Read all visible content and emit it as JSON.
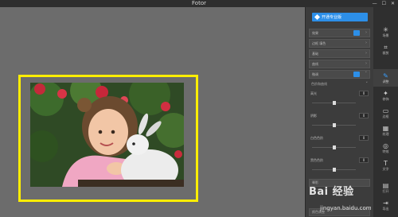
{
  "window": {
    "title": "Fotor",
    "min_label": "—",
    "max_label": "☐",
    "close_label": "✕"
  },
  "panel": {
    "vip_label": "开通专业版",
    "rows": [
      {
        "label": "效果",
        "has_tag": true
      },
      {
        "label": "边框 填色",
        "has_tag": false
      },
      {
        "label": "基础",
        "has_tag": false
      },
      {
        "label": "曲线",
        "has_tag": false
      },
      {
        "label": "微调",
        "has_tag": true
      }
    ],
    "sub_row_label": "色阶和曲线",
    "sliders": [
      {
        "label": "高光",
        "value": "0",
        "level": 0.5
      },
      {
        "label": "阴影",
        "value": "0",
        "level": 0.5
      },
      {
        "label": "白色色阶",
        "value": "0",
        "level": 0.5
      },
      {
        "label": "黑色色阶",
        "value": "0",
        "level": 0.5
      }
    ],
    "footer_rows": [
      "晕影",
      "颜色调整"
    ]
  },
  "tools": [
    {
      "name": "scene",
      "icon": "✳",
      "label": "场景"
    },
    {
      "name": "crop",
      "icon": "⌗",
      "label": "裁剪"
    },
    {
      "name": "adjust",
      "icon": "✎",
      "label": "调整",
      "active": true
    },
    {
      "name": "retouch",
      "icon": "✦",
      "label": "修饰"
    },
    {
      "name": "frame",
      "icon": "▭",
      "label": "边框"
    },
    {
      "name": "texture",
      "icon": "▦",
      "label": "纹理"
    },
    {
      "name": "effect",
      "icon": "◎",
      "label": "特效"
    },
    {
      "name": "text",
      "icon": "T",
      "label": "文字"
    },
    {
      "name": "open",
      "icon": "▤",
      "label": "打开"
    },
    {
      "name": "export",
      "icon": "⇥",
      "label": "导出"
    }
  ],
  "watermark": {
    "text": "Bai 经验",
    "url": "jingyan.baidu.com"
  },
  "colors": {
    "accent": "#2d8fe8",
    "highlight": "#ffee00"
  }
}
